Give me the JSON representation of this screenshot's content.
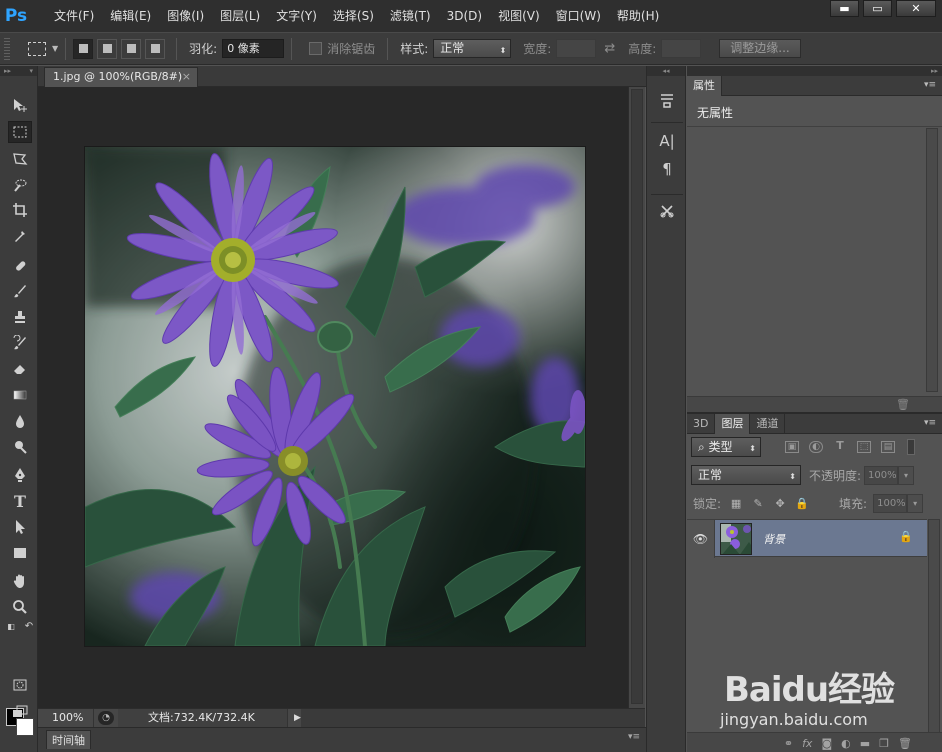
{
  "app": {
    "logo": "Ps"
  },
  "menu": [
    "文件(F)",
    "编辑(E)",
    "图像(I)",
    "图层(L)",
    "文字(Y)",
    "选择(S)",
    "滤镜(T)",
    "3D(D)",
    "视图(V)",
    "窗口(W)",
    "帮助(H)"
  ],
  "window_controls": {
    "minimize": "▬",
    "restore": "▭",
    "close": "✕"
  },
  "options": {
    "feather_label": "羽化:",
    "feather_value": "0 像素",
    "antialias_label": "消除锯齿",
    "style_label": "样式:",
    "style_value": "正常",
    "width_label": "宽度:",
    "height_label": "高度:",
    "refine_edge_button": "调整边缘..."
  },
  "document": {
    "tab_title": "1.jpg @ 100%(RGB/8#)",
    "tab_close": "×",
    "zoom": "100%",
    "doc_info": "文档:732.4K/732.4K"
  },
  "timeline": {
    "tab_label": "时间轴"
  },
  "properties_panel": {
    "tab_label": "属性",
    "empty_text": "无属性"
  },
  "layers_panel": {
    "tabs": [
      "3D",
      "图层",
      "通道"
    ],
    "active_tab": "图层",
    "filter_kind": "类型",
    "blend_mode": "正常",
    "opacity_label": "不透明度:",
    "opacity_value": "100%",
    "lock_label": "锁定:",
    "fill_label": "填充:",
    "fill_value": "100%",
    "layers": [
      {
        "name": "背景",
        "visible": true,
        "locked": true
      }
    ]
  },
  "colors": {
    "foreground": "#000000",
    "background": "#ffffff",
    "selected_layer": "#6b7891",
    "ps_blue": "#2fa4ff"
  },
  "watermark": {
    "brand": "Baidu经验",
    "url": "jingyan.baidu.com"
  }
}
